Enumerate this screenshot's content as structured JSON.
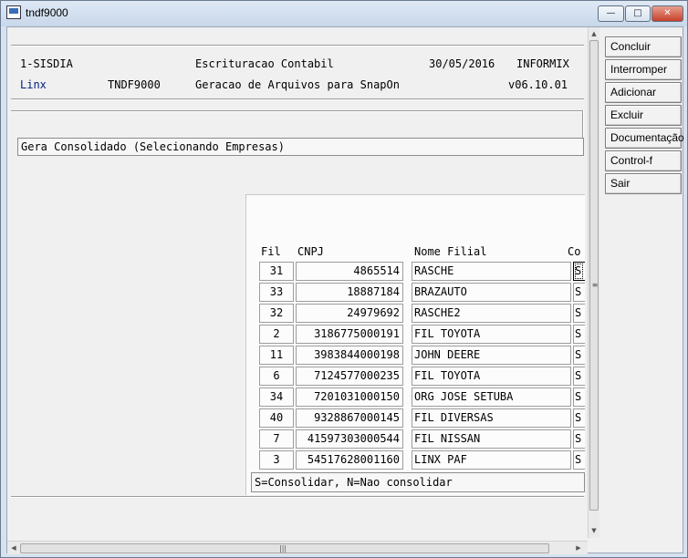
{
  "window": {
    "title": "tndf9000",
    "controls": {
      "minimize": "—",
      "maximize": "□",
      "close": "✕"
    }
  },
  "header": {
    "line1": {
      "system": "1-SISDIA",
      "title": "Escrituracao Contabil",
      "date": "30/05/2016",
      "db": "INFORMIX"
    },
    "line2": {
      "company": "Linx",
      "program": "TNDF9000",
      "subtitle": "Geracao de Arquivos para SnapOn",
      "version": "v06.10.01"
    }
  },
  "section_title": "Gera Consolidado (Selecionando Empresas)",
  "table": {
    "headers": {
      "fil": "Fil",
      "cnpj": "CNPJ",
      "nome": "Nome Filial",
      "con": "Co"
    },
    "rows": [
      {
        "fil": "31",
        "cnpj": "4865514",
        "nome": "RASCHE",
        "con": "S"
      },
      {
        "fil": "33",
        "cnpj": "18887184",
        "nome": "BRAZAUTO",
        "con": "S"
      },
      {
        "fil": "32",
        "cnpj": "24979692",
        "nome": "RASCHE2",
        "con": "S"
      },
      {
        "fil": "2",
        "cnpj": "3186775000191",
        "nome": "FIL TOYOTA",
        "con": "S"
      },
      {
        "fil": "11",
        "cnpj": "3983844000198",
        "nome": "JOHN DEERE",
        "con": "S"
      },
      {
        "fil": "6",
        "cnpj": "7124577000235",
        "nome": "FIL TOYOTA",
        "con": "S"
      },
      {
        "fil": "34",
        "cnpj": "7201031000150",
        "nome": "ORG JOSE SETUBA",
        "con": "S"
      },
      {
        "fil": "40",
        "cnpj": "9328867000145",
        "nome": "FIL DIVERSAS",
        "con": "S"
      },
      {
        "fil": "7",
        "cnpj": "41597303000544",
        "nome": "FIL NISSAN",
        "con": "S"
      },
      {
        "fil": "3",
        "cnpj": "54517628001160",
        "nome": "LINX PAF",
        "con": "S"
      }
    ]
  },
  "status_hint": "S=Consolidar, N=Nao consolidar",
  "side_buttons": [
    "Concluir",
    "Interromper",
    "Adicionar",
    "Excluir",
    "Documentação",
    "Control-f",
    "Sair"
  ],
  "scrollbar": {
    "grip": "≡",
    "hgrip": "|||",
    "up": "▲",
    "down": "▼",
    "left": "◀",
    "right": "▶"
  },
  "colors": {
    "accent_text": "#001f7a",
    "close_button": "#c6402a"
  }
}
